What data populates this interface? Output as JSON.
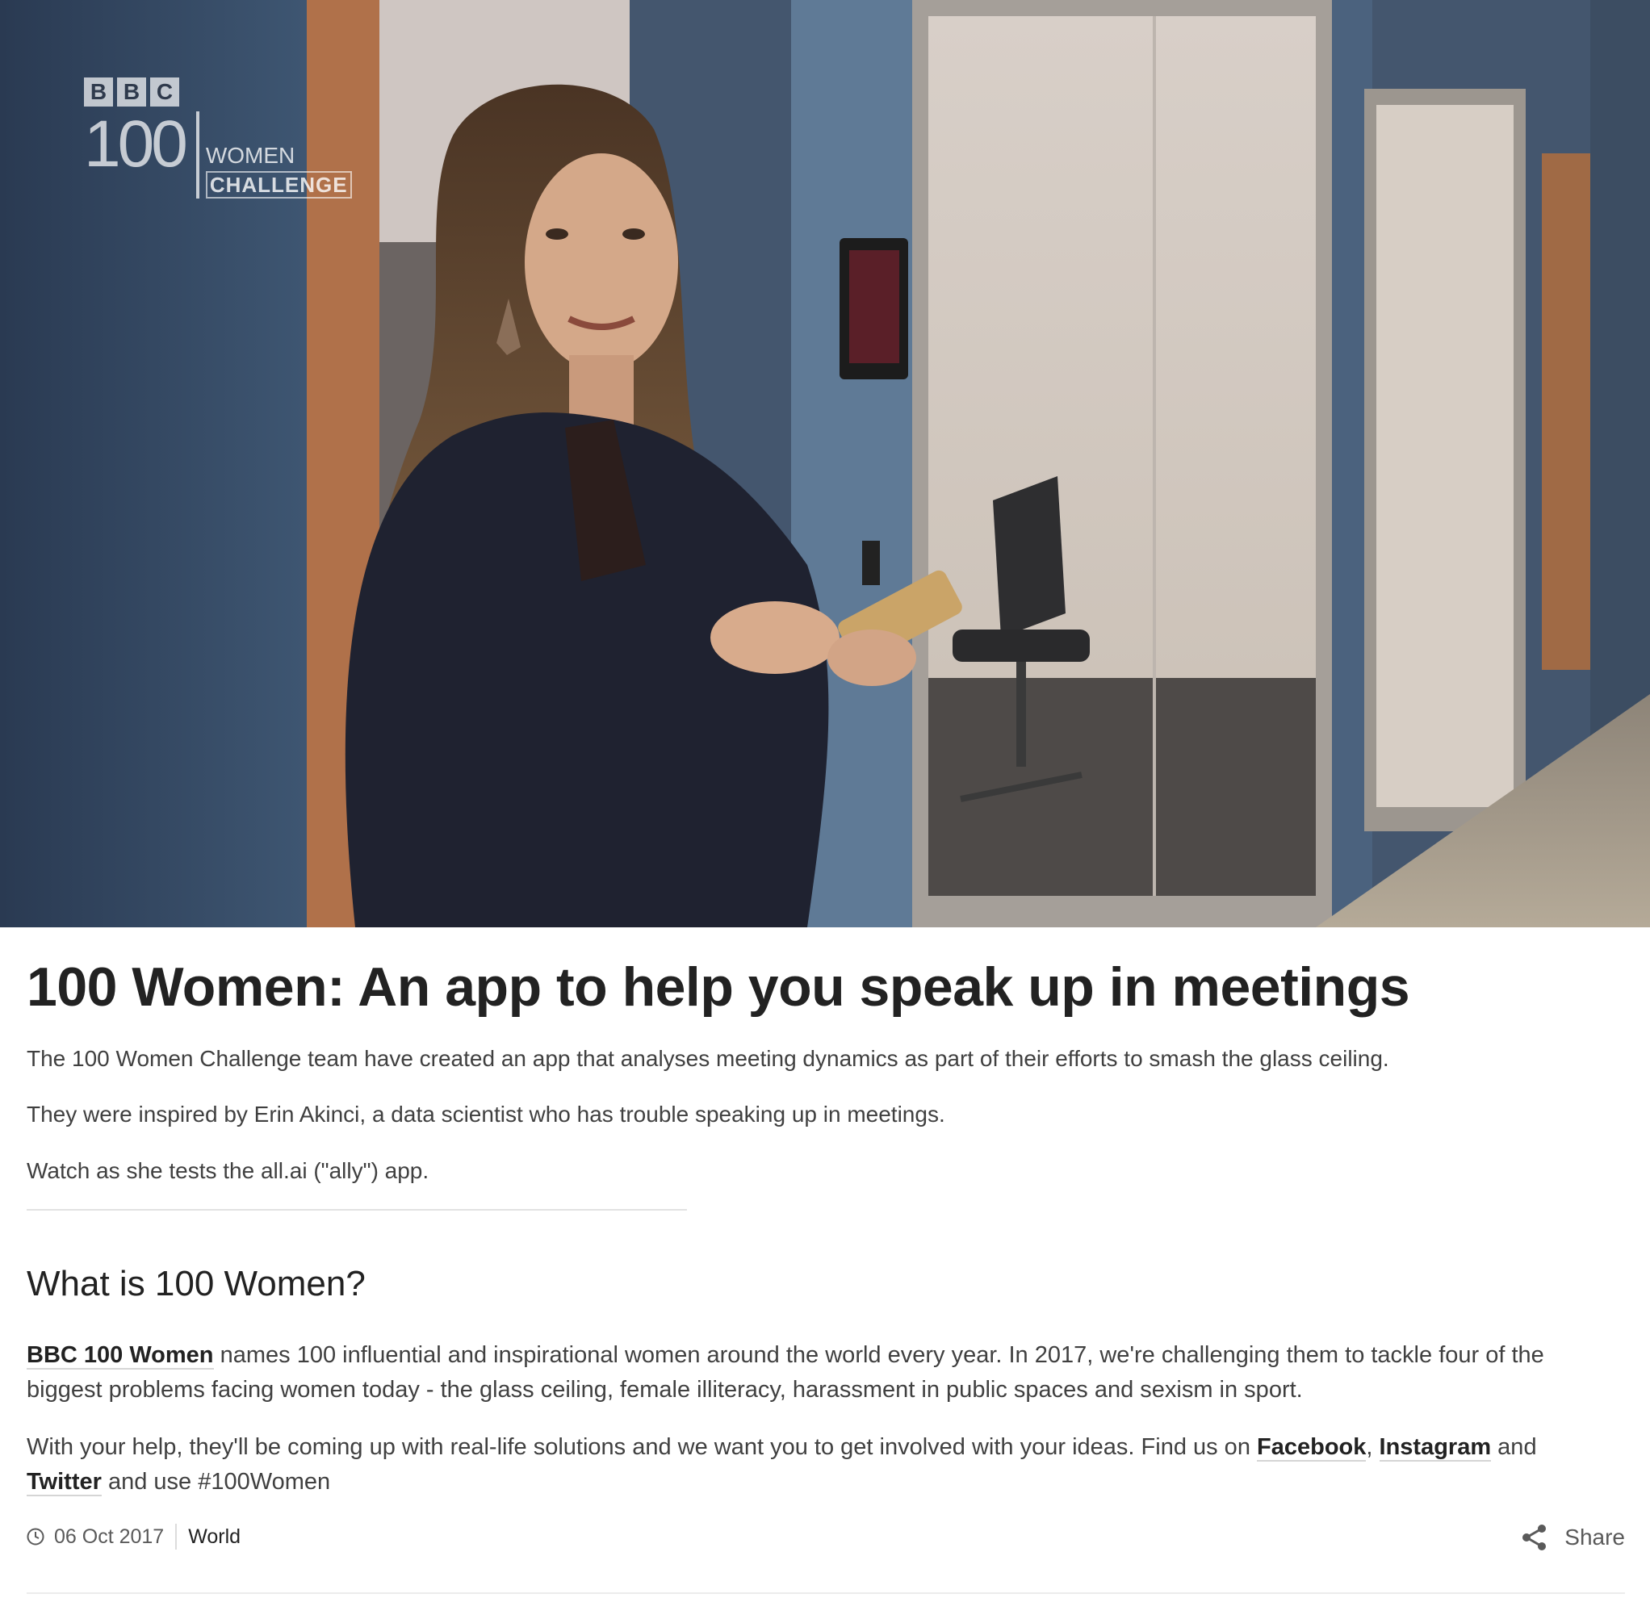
{
  "video": {
    "logo": {
      "bbc_letters": [
        "B",
        "B",
        "C"
      ],
      "number": "100",
      "word": "WOMEN",
      "tag": "CHALLENGE"
    }
  },
  "article": {
    "headline": "100 Women: An app to help you speak up in meetings",
    "intro": [
      "The 100 Women Challenge team have created an app that analyses meeting dynamics as part of their efforts to smash the glass ceiling.",
      "They were inspired by Erin Akinci, a data scientist who has trouble speaking up in meetings.",
      "Watch as she tests the all.ai (\"ally\") app."
    ],
    "subheading": "What is 100 Women?",
    "para1": {
      "link": "BBC 100 Women",
      "text": " names 100 influential and inspirational women around the world every year. In 2017, we're challenging them to tackle four of the biggest problems facing women today - the glass ceiling, female illiteracy, harassment in public spaces and sexism in sport."
    },
    "para2": {
      "text_before": "With your help, they'll be coming up with real-life solutions and we want you to get involved with your ideas. Find us on ",
      "link_facebook": "Facebook",
      "comma": ", ",
      "link_instagram": "Instagram",
      "and": " and ",
      "link_twitter": "Twitter",
      "text_after": " and use #100Women"
    },
    "meta": {
      "date": "06 Oct 2017",
      "topic": "World",
      "icon": "clock-icon"
    },
    "share": {
      "label": "Share",
      "icon": "share-icon"
    }
  }
}
